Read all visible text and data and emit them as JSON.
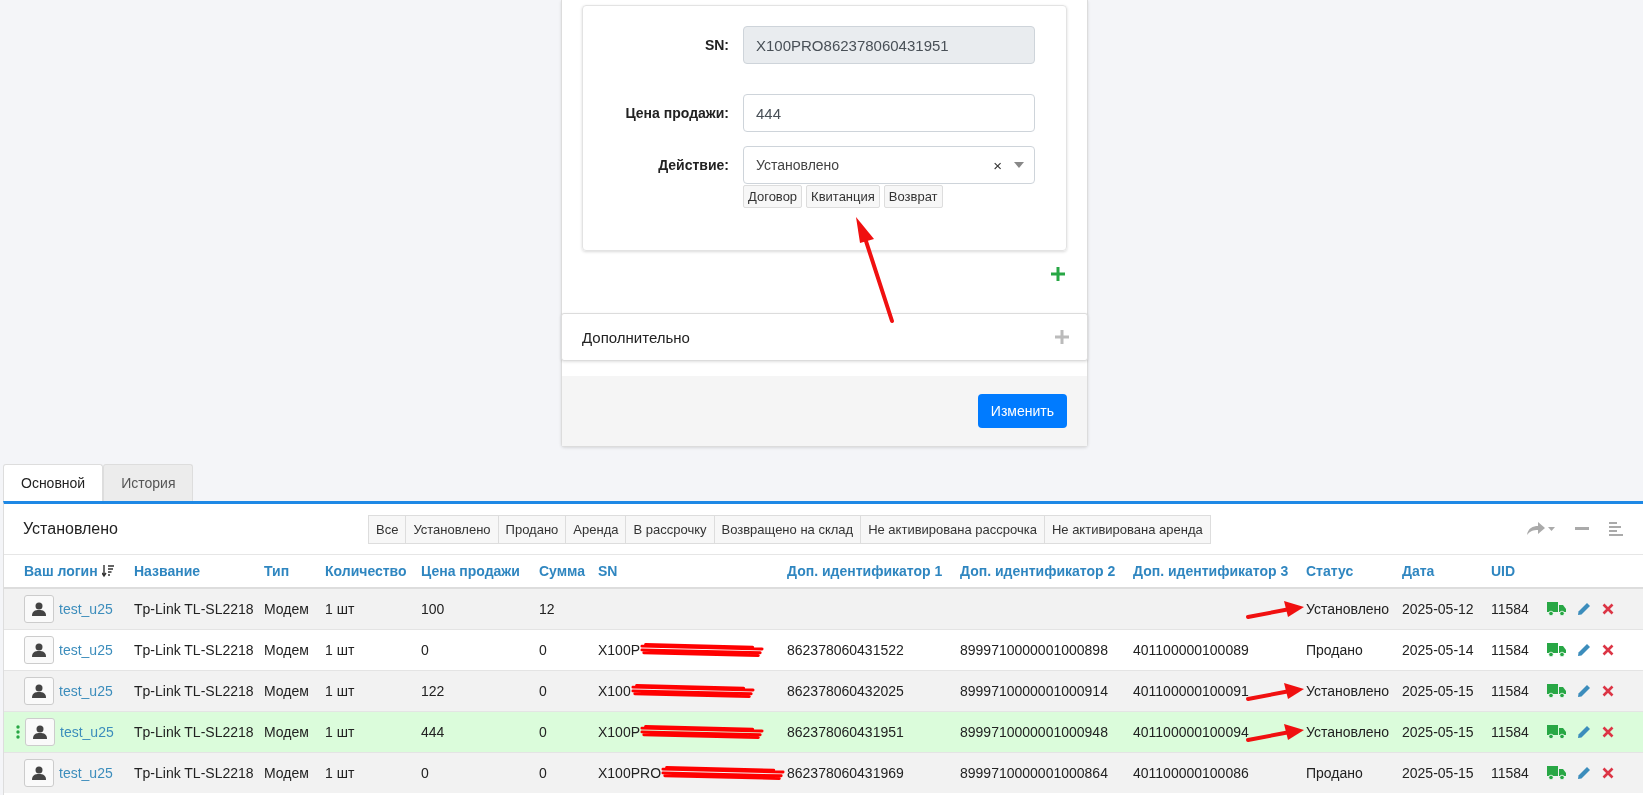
{
  "form": {
    "fields": [
      {
        "kind": "readonly",
        "label": "SN:",
        "value": "X100PRO862378060431951"
      },
      {
        "kind": "text",
        "label": "Цена продажи:",
        "value": "444"
      },
      {
        "kind": "select",
        "label": "Действие:",
        "value": "Установлено",
        "clear": "×",
        "buttons": [
          "Договор",
          "Квитанция",
          "Возврат"
        ]
      }
    ],
    "annotation_arrow": true
  },
  "sections": [
    {
      "title": "Дополнительно",
      "expanded": false
    }
  ],
  "submit": "Изменить",
  "tabs": [
    {
      "label": "Основной",
      "selected": true
    },
    {
      "label": "История",
      "selected": false
    }
  ],
  "table": {
    "title": "Установлено",
    "filters": [
      "Все",
      "Установлено",
      "Продано",
      "Аренда",
      "В рассрочку",
      "Возвращено на склад",
      "Не активирована рассрочка",
      "Не активирована аренда"
    ],
    "columns": [
      {
        "label": "Ваш логин",
        "sorted": true
      },
      {
        "label": "Название",
        "sorted": false
      },
      {
        "label": "Тип",
        "sorted": false
      },
      {
        "label": "Количество",
        "sorted": false
      },
      {
        "label": "Цена продажи",
        "sorted": false
      },
      {
        "label": "Сумма",
        "sorted": false
      },
      {
        "label": "SN",
        "sorted": false
      },
      {
        "label": "Доп. идентификатор 1",
        "sorted": false
      },
      {
        "label": "Доп. идентификатор 2",
        "sorted": false
      },
      {
        "label": "Доп. идентификатор 3",
        "sorted": false
      },
      {
        "label": "Статус",
        "sorted": false
      },
      {
        "label": "Дата",
        "sorted": false
      },
      {
        "label": "UID",
        "sorted": false
      }
    ],
    "rows": [
      {
        "selected": false,
        "redacted": false,
        "annotation_arrow": true,
        "cells": [
          "test_u25",
          "Tp-Link TL-SL2218",
          "Модем",
          "1 шт",
          "100",
          "12",
          "",
          "",
          "",
          "",
          "Установлено",
          "2025-05-12",
          "11584"
        ]
      },
      {
        "selected": false,
        "redacted": true,
        "annotation_arrow": false,
        "cells": [
          "test_u25",
          "Tp-Link TL-SL2218",
          "Модем",
          "1 шт",
          "0",
          "0",
          "X100P",
          "862378060431522",
          "8999710000001000898",
          "401100000100089",
          "Продано",
          "2025-05-14",
          "11584"
        ]
      },
      {
        "selected": false,
        "redacted": true,
        "annotation_arrow": true,
        "cells": [
          "test_u25",
          "Tp-Link TL-SL2218",
          "Модем",
          "1 шт",
          "122",
          "0",
          "X100",
          "862378060432025",
          "8999710000001000914",
          "401100000100091",
          "Установлено",
          "2025-05-15",
          "11584"
        ]
      },
      {
        "selected": true,
        "redacted": true,
        "annotation_arrow": true,
        "cells": [
          "test_u25",
          "Tp-Link TL-SL2218",
          "Модем",
          "1 шт",
          "444",
          "0",
          "X100P",
          "862378060431951",
          "8999710000001000948",
          "401100000100094",
          "Установлено",
          "2025-05-15",
          "11584"
        ]
      },
      {
        "selected": false,
        "redacted": true,
        "annotation_arrow": false,
        "cells": [
          "test_u25",
          "Tp-Link TL-SL2218",
          "Модем",
          "1 шт",
          "0",
          "0",
          "X100PRO",
          "862378060431969",
          "8999710000001000864",
          "401100000100086",
          "Продано",
          "2025-05-15",
          "11584"
        ]
      }
    ]
  }
}
